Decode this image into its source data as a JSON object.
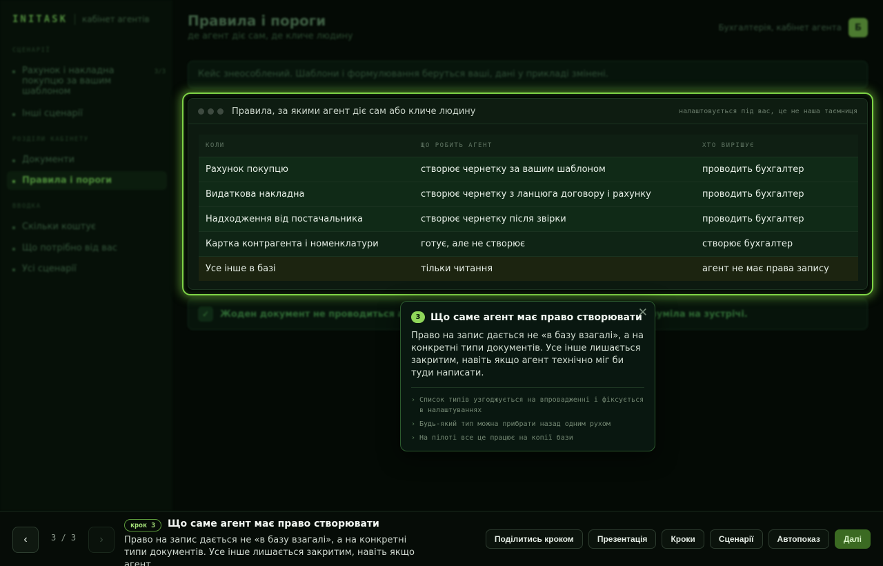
{
  "app": {
    "logo": "INITASK",
    "subtitle": "кабінет агентів",
    "page_title": "Правила і пороги",
    "page_subtitle": "де агент діє сам, де кличе людину",
    "account_label": "Бухгалтерія, кабінет агента",
    "avatar_letter": "Б"
  },
  "sidebar": {
    "group_scenarios": "СЦЕНАРІЇ",
    "scenario_item_1": "Рахунок і накладна покупцю за вашим шаблоном",
    "scenario_item_1_count": "3/3",
    "scenario_item_2": "Інші сценарії",
    "group_sections": "РОЗДІЛИ КАБІНЕТУ",
    "section_item_1": "Документи",
    "section_item_2": "Правила і пороги",
    "group_intro": "ВВОДКА",
    "intro_item_1": "Скільки коштує",
    "intro_item_2": "Що потрібно від вас",
    "intro_item_3": "Усі сценарії"
  },
  "notice": {
    "text": "Кейс знеособлений. Шаблони і формулювання беруться ваші, дані у прикладі змінені."
  },
  "success_banner": {
    "icon": "check-icon",
    "text": "Жоден документ не проводиться агентом самостійно, бухгалтерія бачила це і зрозуміла на зустрічі."
  },
  "panel": {
    "title": "Правила, за якими агент діє сам або кличе людину",
    "meta": "налаштовується під вас, це не наша таємниця",
    "columns": [
      "КОЛИ",
      "ЩО РОБИТЬ АГЕНТ",
      "ХТО ВИРІШУЄ"
    ],
    "rows": [
      [
        "Рахунок покупцю",
        "створює чернетку за вашим шаблоном",
        "проводить бухгалтер"
      ],
      [
        "Видаткова накладна",
        "створює чернетку з ланцюга договору і рахунку",
        "проводить бухгалтер"
      ],
      [
        "Надходження від постачальника",
        "створює чернетку після звірки",
        "проводить бухгалтер"
      ],
      [
        "Картка контрагента і номенклатури",
        "готує, але не створює",
        "створює бухгалтер"
      ],
      [
        "Усе інше в базі",
        "тільки читання",
        "агент не має права запису"
      ]
    ]
  },
  "tooltip": {
    "step_number": "3",
    "title": "Що саме агент має право створювати",
    "text": "Право на запис дається не «в базу взагалі», а на конкретні типи документів. Усе інше лишається закритим, навіть якщо агент технічно міг би туди написати.",
    "bullets": [
      "Список типів узгоджується на впровадженні і фіксується в налаштуваннях",
      "Будь-який тип можна прибрати назад одним рухом",
      "На пілоті все це працює на копії бази"
    ],
    "close_icon": "close-icon"
  },
  "tour": {
    "prev_icon": "‹",
    "next_icon": "›",
    "counter": "3 / 3",
    "step_badge": "крок 3",
    "step_title": "Що саме агент має право створювати",
    "step_text": "Право на запис дається не «в базу взагалі», а на конкретні типи документів. Усе інше лишається закритим, навіть якщо агент...",
    "actions": {
      "share": "Поділитись кроком",
      "presentation": "Презентація",
      "steps": "Кроки",
      "scenarios": "Сценарії",
      "autoplay": "Автопоказ",
      "next": "Далі"
    }
  },
  "colors": {
    "accent": "#7fd346",
    "primary_button": "#3b6a22",
    "background": "#040a05"
  }
}
